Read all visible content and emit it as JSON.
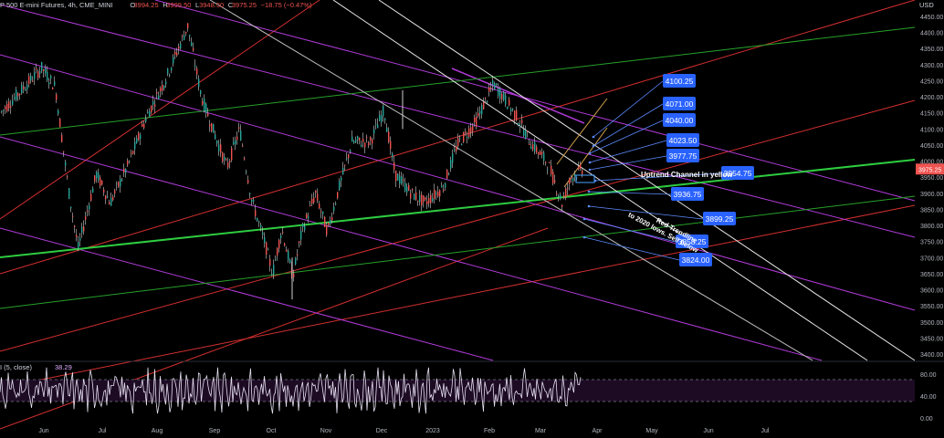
{
  "header": {
    "symbol": "P 500 E-mini Futures, 4h, CME_MINI",
    "open_label": "O",
    "open": "3994.25",
    "high_label": "H",
    "high": "3999.50",
    "low_label": "L",
    "low": "3948.50",
    "close_label": "C",
    "close": "3975.25",
    "change": "−18.75 (−0.47%)"
  },
  "currency": "USD",
  "last_price": "3975.25",
  "annotations": {
    "uptrend_text": "Uptrend Channel in yellow",
    "red_trendline_text_1": "Red Trendline",
    "red_trendline_text_2": "to 2020 lows. Sell below"
  },
  "price_tags": [
    "4100.25",
    "4071.00",
    "4040.00",
    "4023.50",
    "3977.75",
    "3954.75",
    "3936.75",
    "3899.25",
    "3858.25",
    "3824.00"
  ],
  "rsi": {
    "label": "I (5, close)",
    "value": "38.29"
  },
  "chart_data": [
    {
      "type": "line",
      "title": "P 500 E-mini Futures, 4h, CME_MINI",
      "y_axis_ticks": [
        "4450.00",
        "4400.00",
        "4350.00",
        "4300.00",
        "4250.00",
        "4200.00",
        "4150.00",
        "4100.00",
        "4050.00",
        "4000.00",
        "3950.00",
        "3900.00",
        "3850.00",
        "3800.00",
        "3750.00",
        "3700.00",
        "3650.00",
        "3600.00",
        "3550.00",
        "3500.00",
        "3450.00",
        "3400.00"
      ],
      "ylim": [
        3380,
        4470
      ],
      "x_axis_ticks": [
        "Jun",
        "Jul",
        "Aug",
        "Sep",
        "Oct",
        "Nov",
        "Dec",
        "2023",
        "Feb",
        "Mar",
        "Apr",
        "May",
        "Jun",
        "Jul"
      ],
      "series": [
        {
          "x": [
            "May",
            "Jun",
            "Jun",
            "Jul",
            "Jul",
            "Aug",
            "Aug",
            "Sep",
            "Sep",
            "Oct",
            "Oct",
            "Nov",
            "Nov",
            "Dec",
            "Dec",
            "2023",
            "Jan",
            "Feb",
            "Feb",
            "Mar",
            "Mar"
          ],
          "values": [
            4150,
            4290,
            3900,
            3730,
            4000,
            4420,
            4180,
            3940,
            4060,
            3640,
            3840,
            3760,
            4060,
            4160,
            3850,
            3880,
            4000,
            4240,
            4120,
            3860,
            3975
          ]
        }
      ],
      "grid": false
    },
    {
      "type": "line",
      "title": "",
      "series": [
        {
          "name": "I (5, close)",
          "last": 38.29
        }
      ],
      "y_axis_ticks": [
        "80.00",
        "40.00",
        "0.00"
      ],
      "ylim": [
        0,
        100
      ]
    }
  ]
}
